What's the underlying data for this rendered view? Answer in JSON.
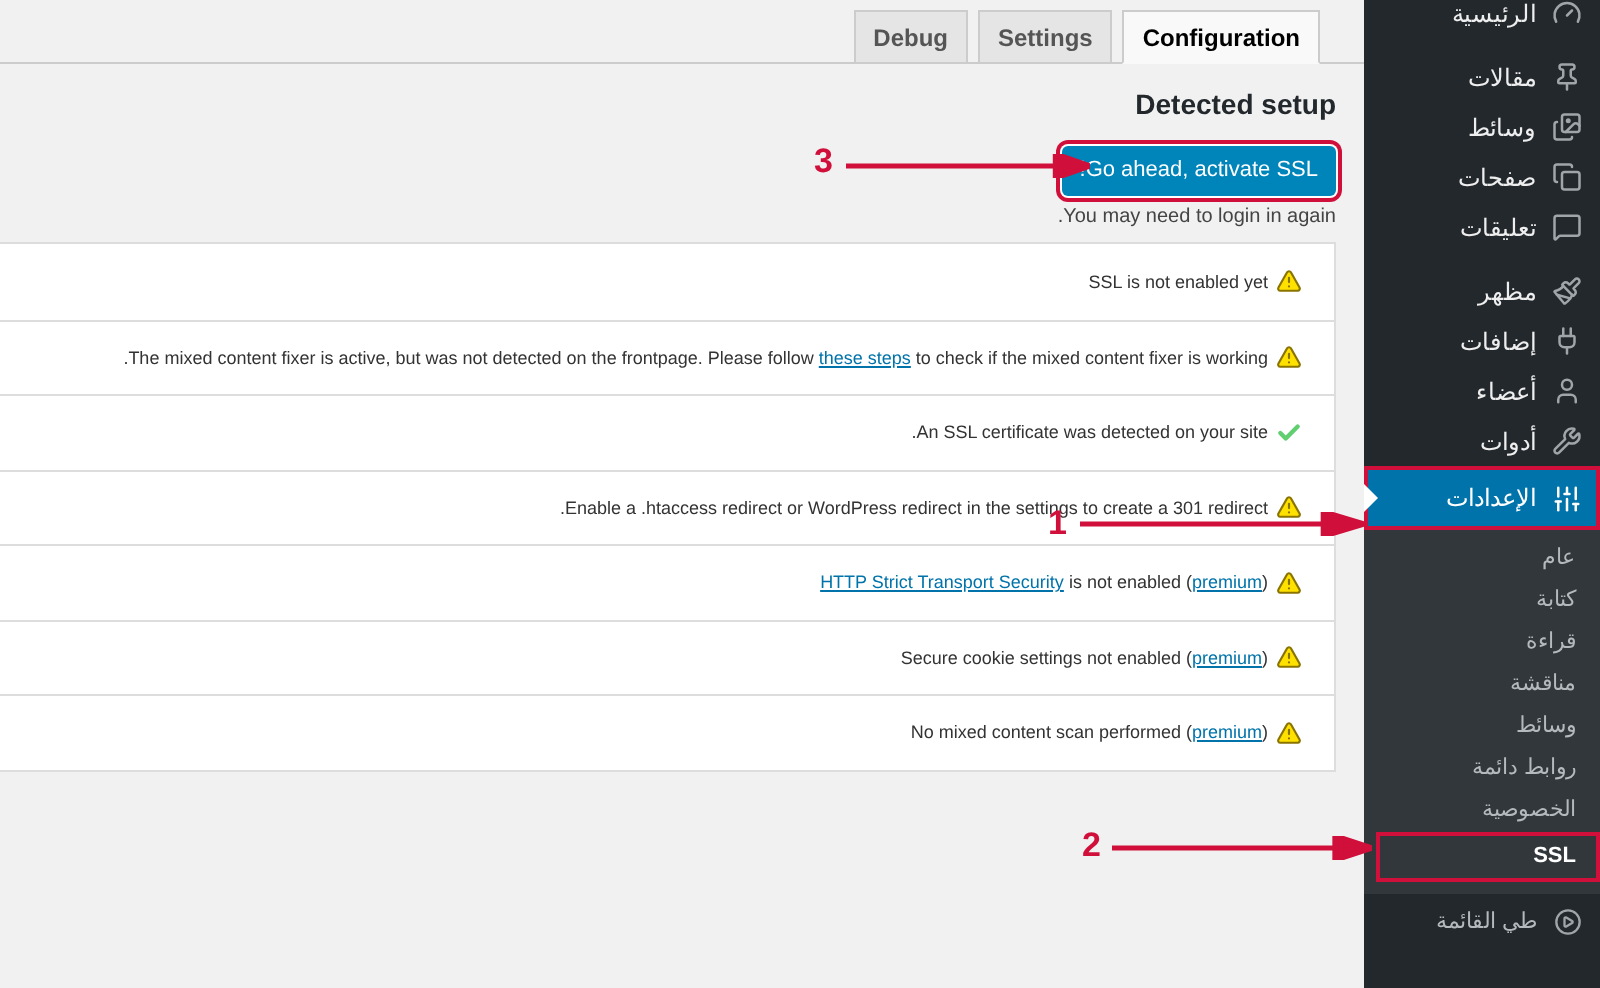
{
  "tabs": [
    {
      "label": "Configuration",
      "selected": true
    },
    {
      "label": "Settings",
      "selected": false
    },
    {
      "label": "Debug",
      "selected": false
    }
  ],
  "heading": "Detected setup",
  "activate_button": "Go ahead, activate SSL!",
  "login_note": "You may need to login in again.",
  "notices": [
    {
      "kind": "warning",
      "text": "SSL is not enabled yet"
    },
    {
      "kind": "warning",
      "text": ".The mixed content fixer is active, but was not detected on the frontpage. Please follow ",
      "link": "these steps",
      "after": " to check if the mixed content fixer is working"
    },
    {
      "kind": "success",
      "text": ".An SSL certificate was detected on your site"
    },
    {
      "kind": "warning",
      "text": ".Enable a .htaccess redirect or WordPress redirect in the settings to create a 301 redirect"
    },
    {
      "kind": "warning",
      "lead_link": "HTTP Strict Transport Security",
      "text": " is not enabled (",
      "link": "premium",
      "after": ")"
    },
    {
      "kind": "warning",
      "text": "Secure cookie settings not enabled (",
      "link": "premium",
      "after": ")"
    },
    {
      "kind": "warning",
      "text": "No mixed content scan performed (",
      "link": "premium",
      "after": ")"
    }
  ],
  "sidebar": {
    "groups": [
      [
        {
          "label": "الرئيسية",
          "selected": false
        }
      ],
      [
        {
          "label": "مقالات",
          "selected": false
        },
        {
          "label": "وسائط",
          "selected": false
        },
        {
          "label": "صفحات",
          "selected": false
        },
        {
          "label": "تعليقات",
          "selected": false
        }
      ],
      [
        {
          "label": "مظهر",
          "selected": false
        },
        {
          "label": "إضافات",
          "selected": false
        },
        {
          "label": "أعضاء",
          "selected": false
        },
        {
          "label": "أدوات",
          "selected": false
        },
        {
          "label": "الإعدادات",
          "selected": true,
          "children": [
            {
              "label": "عام",
              "selected": false
            },
            {
              "label": "كتابة",
              "selected": false
            },
            {
              "label": "قراءة",
              "selected": false
            },
            {
              "label": "مناقشة",
              "selected": false
            },
            {
              "label": "وسائط",
              "selected": false
            },
            {
              "label": "روابط دائمة",
              "selected": false
            },
            {
              "label": "الخصوصية",
              "selected": false
            },
            {
              "label": "SSL",
              "selected": true
            }
          ]
        }
      ]
    ],
    "collapse": "طي القائمة"
  },
  "annotations": [
    "1",
    "2",
    "3"
  ]
}
